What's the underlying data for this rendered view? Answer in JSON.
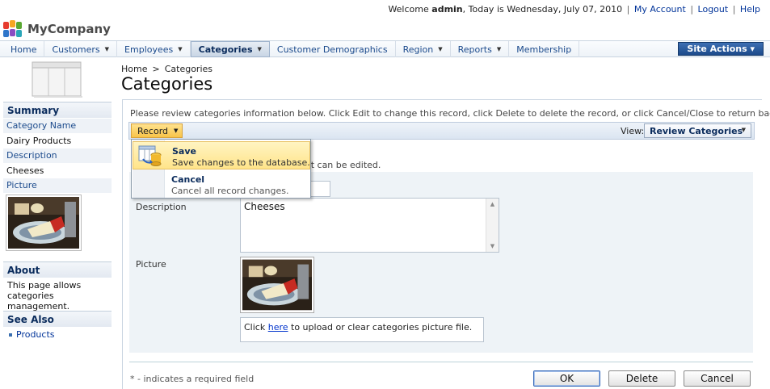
{
  "topbar": {
    "welcome_prefix": "Welcome",
    "user": "admin",
    "date_text": ", Today is Wednesday, July 07, 2010",
    "sep": "|",
    "my_account": "My Account",
    "logout": "Logout",
    "help": "Help"
  },
  "brand": {
    "name": "MyCompany"
  },
  "nav": {
    "items": [
      {
        "label": "Home"
      },
      {
        "label": "Customers",
        "caret": "▼"
      },
      {
        "label": "Employees",
        "caret": "▼"
      },
      {
        "label": "Categories",
        "caret": "▼"
      },
      {
        "label": "Customer Demographics"
      },
      {
        "label": "Region",
        "caret": "▼"
      },
      {
        "label": "Reports",
        "caret": "▼"
      },
      {
        "label": "Membership"
      }
    ],
    "site_actions": "Site Actions ▾"
  },
  "sidebar": {
    "summary_title": "Summary",
    "category_name_label": "Category Name",
    "category_name_value": "Dairy Products",
    "description_label": "Description",
    "description_value": "Cheeses",
    "picture_label": "Picture",
    "about_title": "About",
    "about_text": "This page allows categories management.",
    "see_also_title": "See Also",
    "see_also_link": "Products"
  },
  "breadcrumb": {
    "home": "Home",
    "sep": ">",
    "current": "Categories"
  },
  "page": {
    "title": "Categories",
    "intro": "Please review categories information below. Click Edit to change this record, click Delete to delete the record, or click Cancel/Close to return back."
  },
  "toolbar": {
    "record_label": "Record",
    "view_label": "View:",
    "view_value": "Review Categories"
  },
  "menu": {
    "save_title": "Save",
    "save_desc": "Save changes to the database.",
    "cancel_title": "Cancel",
    "cancel_desc": "Cancel all record changes."
  },
  "form": {
    "partial_desc": "hat can be edited.",
    "description_label": "Description",
    "description_value": "Cheeses",
    "picture_label": "Picture",
    "upload_prefix": "Click",
    "upload_link": "here",
    "upload_suffix": "to upload or clear categories picture file."
  },
  "footer": {
    "required_note": "* - indicates a required field",
    "ok": "OK",
    "delete": "Delete",
    "cancel": "Cancel"
  },
  "colors": {
    "nav_text": "#1b4a8c",
    "accent": "#0a2b5c",
    "highlight": "#ffe48a",
    "site_actions": "#1c4a8a"
  }
}
